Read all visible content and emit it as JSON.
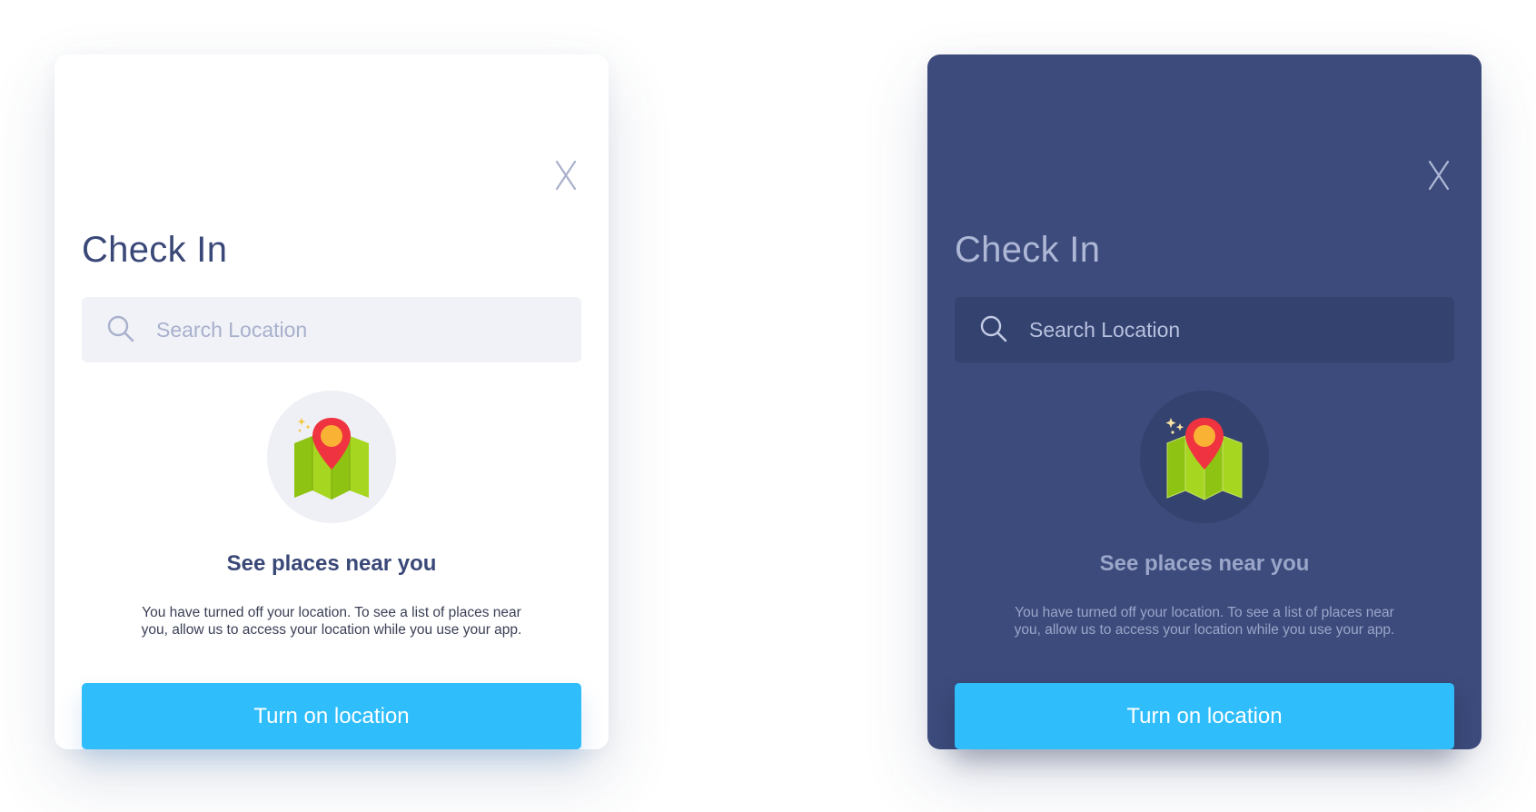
{
  "colors": {
    "light_card_bg": "#ffffff",
    "dark_card_bg": "#3c4b7b",
    "accent": "#2fbdfb",
    "title_light": "#3a4878",
    "title_dark": "#aeb7d6"
  },
  "icons": {
    "close": "close-icon",
    "search": "search-icon",
    "illustration": "map-pin-icon"
  },
  "light_card": {
    "close_label": "X",
    "title": "Check In",
    "search": {
      "placeholder": "Search Location",
      "value": ""
    },
    "heading": "See places near you",
    "description": "You have turned off your location. To see a list of places near you, allow us to access your location while you use your app.",
    "button_label": "Turn on location"
  },
  "dark_card": {
    "close_label": "X",
    "title": "Check In",
    "search": {
      "placeholder": "Search Location",
      "value": ""
    },
    "heading": "See places near you",
    "description": "You have turned off your location. To see a list of places near you, allow us to access your location while you use your app.",
    "button_label": "Turn on location"
  }
}
